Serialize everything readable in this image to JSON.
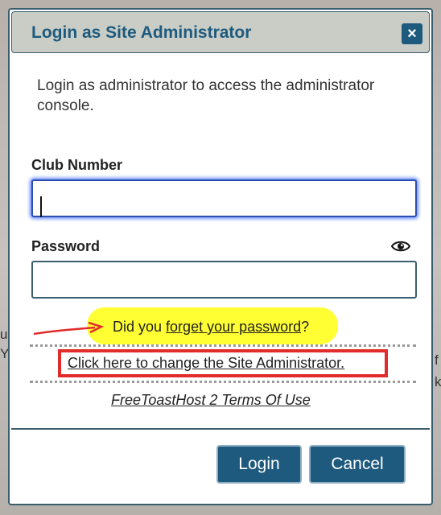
{
  "dialog": {
    "title": "Login as Site Administrator",
    "close_label": "×",
    "intro": "Login as administrator to access the administrator console."
  },
  "form": {
    "club_number": {
      "label": "Club Number",
      "value": ""
    },
    "password": {
      "label": "Password",
      "value": ""
    }
  },
  "links": {
    "forgot_prefix": "Did you ",
    "forgot_link": "forget your password",
    "forgot_suffix": "?",
    "change_admin": "Click here to change the Site Administrator.",
    "terms": "FreeToastHost 2 Terms Of Use"
  },
  "buttons": {
    "login": "Login",
    "cancel": "Cancel"
  },
  "background": {
    "left_text": "u",
    "left_text2": "Y",
    "right_text": "f",
    "right_text2": "k"
  },
  "colors": {
    "accent": "#1e5a7e",
    "highlight": "#ffff33",
    "annotation_red": "#e22b2b"
  },
  "icons": {
    "close": "close-icon",
    "password_toggle": "eye-icon",
    "annotation": "red-arrow-icon"
  }
}
